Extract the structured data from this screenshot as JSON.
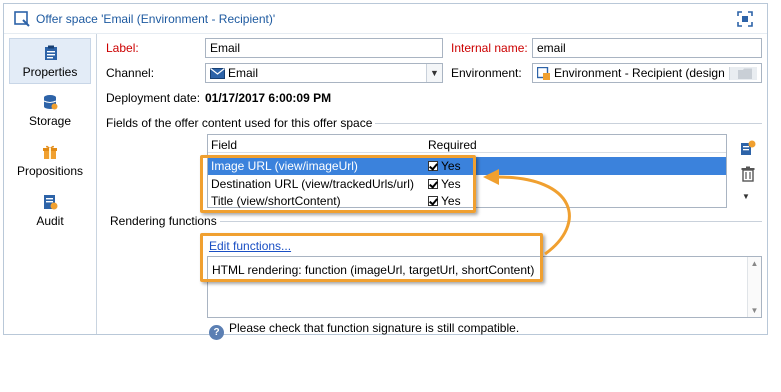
{
  "window": {
    "title": "Offer space 'Email (Environment - Recipient)'"
  },
  "sidebar": {
    "items": [
      {
        "label": "Properties",
        "icon": "clipboard-icon",
        "active": true
      },
      {
        "label": "Storage",
        "icon": "database-icon",
        "active": false
      },
      {
        "label": "Propositions",
        "icon": "gift-icon",
        "active": false
      },
      {
        "label": "Audit",
        "icon": "audit-icon",
        "active": false
      }
    ]
  },
  "form": {
    "label_caption": "Label:",
    "label_value": "Email",
    "internal_name_caption": "Internal name:",
    "internal_name_value": "email",
    "channel_caption": "Channel:",
    "channel_value": "Email",
    "environment_caption": "Environment:",
    "environment_value": "Environment - Recipient (design",
    "deployment_caption": "Deployment date:",
    "deployment_value": "01/17/2017 6:00:09 PM"
  },
  "fields_group": {
    "title": "Fields of the offer content used for this offer space",
    "columns": [
      "Field",
      "Required"
    ],
    "rows": [
      {
        "field": "Image URL (view/imageUrl)",
        "required": "Yes",
        "selected": true
      },
      {
        "field": "Destination URL (view/trackedUrls/url)",
        "required": "Yes",
        "selected": false
      },
      {
        "field": "Title (view/shortContent)",
        "required": "Yes",
        "selected": false
      }
    ]
  },
  "rendering": {
    "title": "Rendering functions",
    "edit_link": "Edit functions...",
    "html_rendering": "HTML rendering: function (imageUrl, targetUrl, shortContent)"
  },
  "note": {
    "text": "Please check that function signature is still compatible."
  },
  "colors": {
    "highlight": "#f0a030",
    "selection": "#3b82dc",
    "title": "#1e5aa0",
    "required_label": "#cc0000",
    "link": "#1a4fc4"
  }
}
